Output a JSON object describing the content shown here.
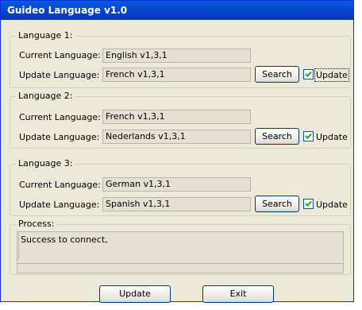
{
  "window": {
    "title": "Guideo Language v1.0"
  },
  "labels": {
    "current": "Current Language:",
    "update": "Update Language:"
  },
  "groups": [
    {
      "legend": "Language 1:",
      "current": "English v1,3,1",
      "update": "French v1,3,1",
      "search": "Search",
      "checkbox_label": "Update",
      "checked": true
    },
    {
      "legend": "Language 2:",
      "current": "French v1,3,1",
      "update": "Nederlands v1,3,1",
      "search": "Search",
      "checkbox_label": "Update",
      "checked": true
    },
    {
      "legend": "Language 3:",
      "current": "German v1,3,1",
      "update": "Spanish v1,3,1",
      "search": "Search",
      "checkbox_label": "Update",
      "checked": true
    }
  ],
  "process": {
    "legend": "Process:",
    "text": "Success to connect,"
  },
  "buttons": {
    "update": "Update",
    "exit": "Exit"
  }
}
